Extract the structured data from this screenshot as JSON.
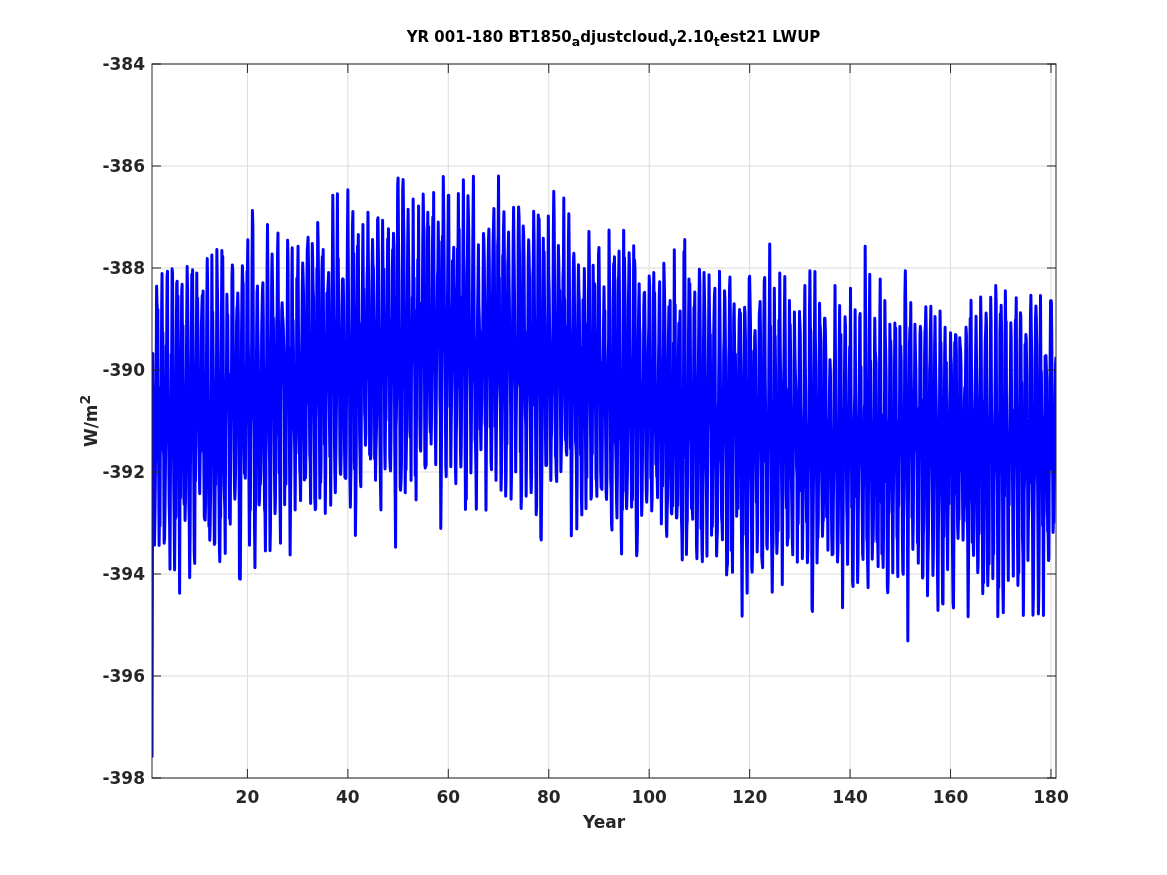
{
  "figure": {
    "title": "YR 001-180 BT1850$_{a}$djustcloud$_{v}$2.10$_{t}$est21 LWUP",
    "ylabel": "W/m$^{2}$",
    "xlabel": "Year",
    "yticks": [
      "-384",
      "-386",
      "-388",
      "-390",
      "-392",
      "-394",
      "-396",
      "-398"
    ],
    "xticks": [
      "20",
      "40",
      "60",
      "80",
      "100",
      "120",
      "140",
      "160",
      "180"
    ]
  }
}
